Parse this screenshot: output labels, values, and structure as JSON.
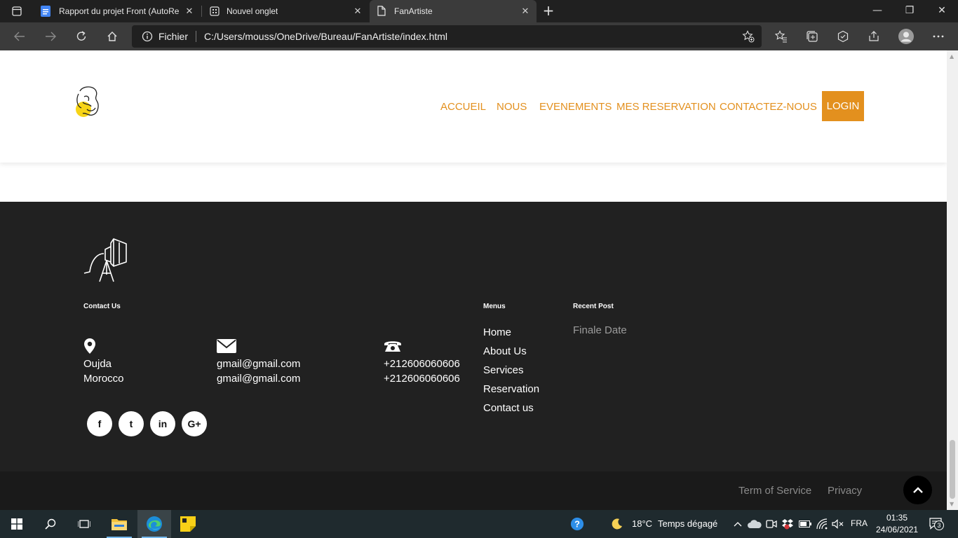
{
  "browser": {
    "tabs": [
      {
        "title": "Rapport du projet Front (AutoRe",
        "close": "✕"
      },
      {
        "title": "Nouvel onglet",
        "close": "✕"
      },
      {
        "title": "FanArtiste",
        "close": "✕"
      }
    ],
    "new_tab": "+",
    "window_controls": {
      "minimize": "—",
      "maximize": "❐",
      "close": "✕"
    },
    "address": {
      "scheme": "Fichier",
      "url": "C:/Users/mouss/OneDrive/Bureau/FanArtiste/index.html"
    }
  },
  "site": {
    "nav": {
      "items": [
        "ACCUEIL",
        "NOUS",
        "EVENEMENTS",
        "MES RESERVATION",
        "CONTACTEZ-NOUS"
      ],
      "login": "LOGIN"
    },
    "footer": {
      "contact_title": "Contact Us",
      "menus_title": "Menus",
      "recent_title": "Recent Post",
      "address": [
        "Oujda",
        "Morocco"
      ],
      "emails": [
        "gmail@gmail.com",
        "gmail@gmail.com"
      ],
      "phones": [
        "+212606060606",
        "+212606060606"
      ],
      "menu_links": [
        "Home",
        "About Us",
        "Services",
        "Reservation",
        "Contact us"
      ],
      "recent_post": "Finale Date",
      "social": [
        "f",
        "t",
        "in",
        "G+"
      ],
      "bottom_links": [
        "Term of Service",
        "Privacy"
      ]
    },
    "accent_color": "#e3901e"
  },
  "taskbar": {
    "weather": {
      "temp": "18°C",
      "condition": "Temps dégagé"
    },
    "language": "FRA",
    "time": "01:35",
    "date": "24/06/2021",
    "notifications": "3"
  }
}
